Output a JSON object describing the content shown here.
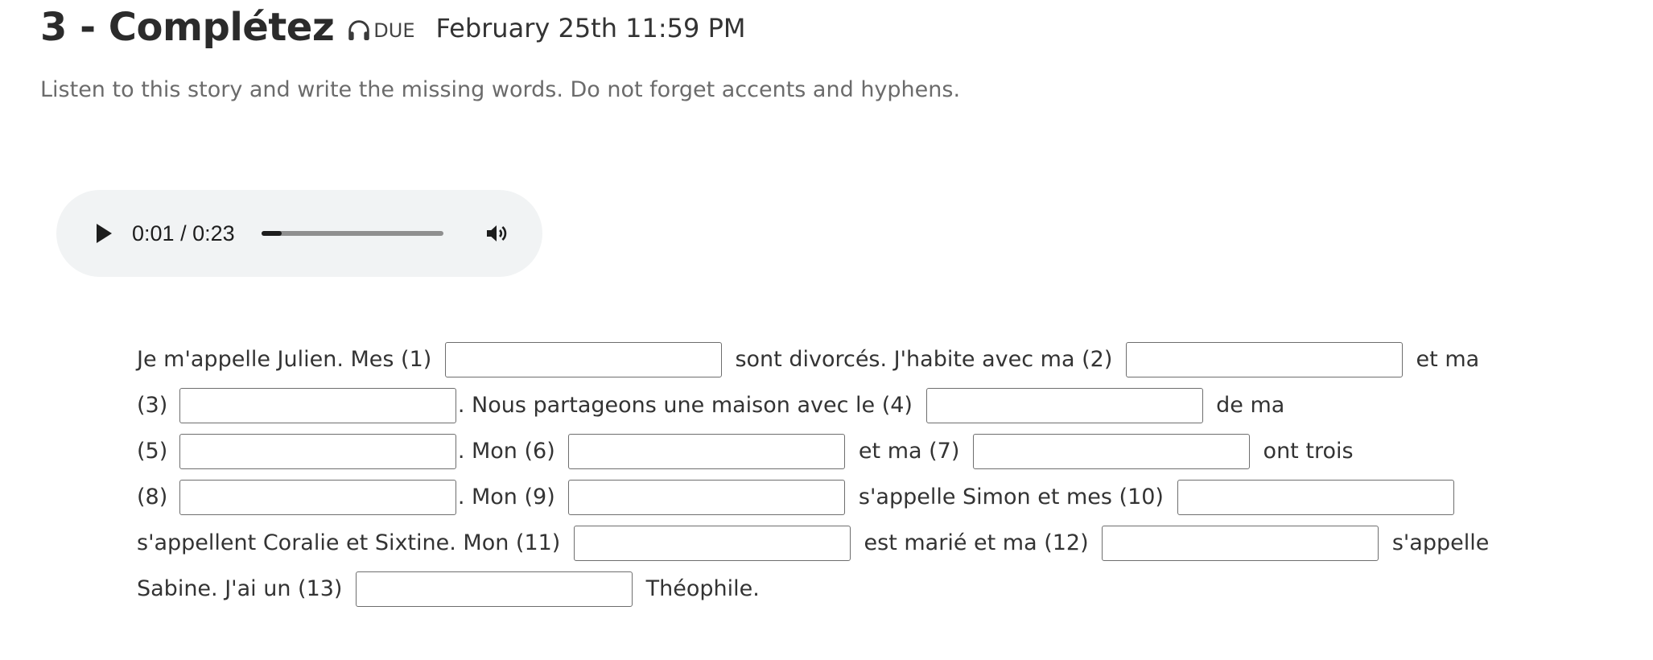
{
  "header": {
    "title": "3 - Complétez",
    "audio_icon": "headphones-icon",
    "due_label": "DUE",
    "due_date": "February 25th 11:59 PM"
  },
  "instructions": "Listen to this story and write the missing words. Do not forget accents and hyphens.",
  "audio_player": {
    "current_time": "0:01",
    "separator": " / ",
    "duration": "0:23",
    "progress_fraction": 0.11,
    "play_icon": "play-icon",
    "volume_icon": "volume-icon"
  },
  "passage": {
    "segments": {
      "s1": "Je m'appelle Julien. Mes (1) ",
      "s2": " sont divorcés. J'habite avec ma (2) ",
      "s3": " et ma",
      "s4": "(3) ",
      "s5": ". Nous partageons une maison avec le (4) ",
      "s6": " de ma",
      "s7": "(5) ",
      "s8": ". Mon (6) ",
      "s9": " et ma (7) ",
      "s10": " ont trois",
      "s11": "(8) ",
      "s12": ". Mon (9) ",
      "s13": " s'appelle Simon et mes (10) ",
      "s14": "s'appellent Coralie et Sixtine. Mon (11) ",
      "s15": " est marié et ma (12) ",
      "s16": " s'appelle",
      "s17": "Sabine. J'ai un (13) ",
      "s18": " Théophile."
    },
    "blanks": {
      "b1": "",
      "b2": "",
      "b3": "",
      "b4": "",
      "b5": "",
      "b6": "",
      "b7": "",
      "b8": "",
      "b9": "",
      "b10": "",
      "b11": "",
      "b12": "",
      "b13": ""
    }
  }
}
